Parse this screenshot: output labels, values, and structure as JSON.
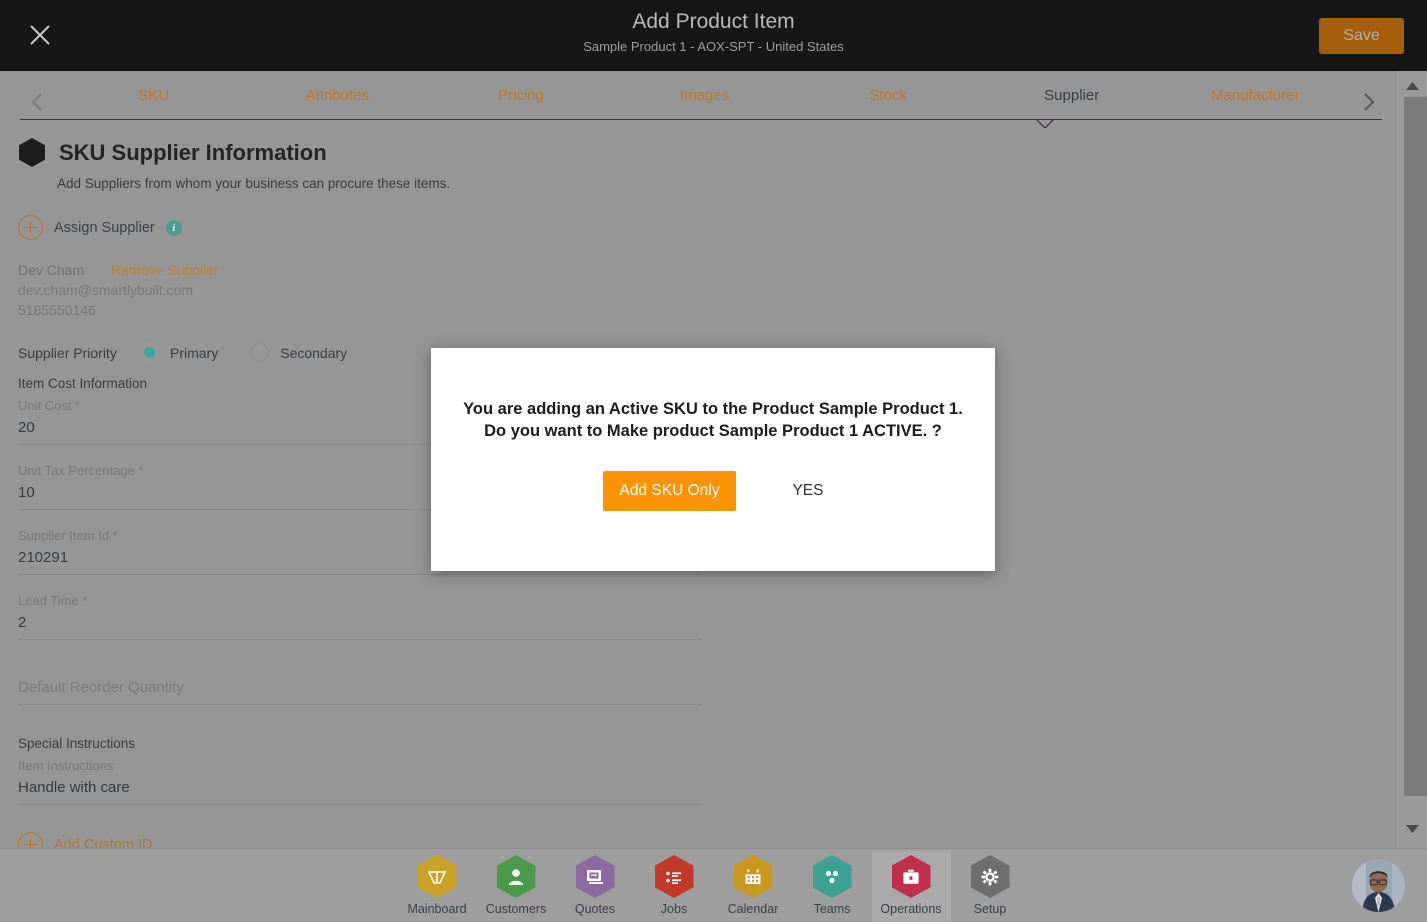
{
  "header": {
    "close_icon": "close-icon",
    "title": "Add Product Item",
    "subtitle": "Sample Product 1 - AOX-SPT - United States",
    "save_label": "Save"
  },
  "tabbar": {
    "prev_icon": "chevron-left-icon",
    "next_icon": "chevron-right-icon",
    "active_tab": "Supplier",
    "tabs": [
      {
        "label": "SKU"
      },
      {
        "label": "Attributes"
      },
      {
        "label": "Pricing"
      },
      {
        "label": "Images"
      },
      {
        "label": "Stock"
      },
      {
        "label": "Supplier"
      },
      {
        "label": "Manufacturer"
      }
    ]
  },
  "section": {
    "title": "SKU Supplier Information",
    "subtitle": "Add Suppliers from whom your business can procure these items.",
    "assign_supplier_label": "Assign Supplier",
    "info_icon_char": "i"
  },
  "supplier": {
    "name": "Dev Cham",
    "remove_label": "Remove Supplier",
    "email": "dev.cham@smartlybuilt.com",
    "phone": "5185550146",
    "priority_label": "Supplier Priority",
    "priority_options": [
      {
        "label": "Primary",
        "selected": true
      },
      {
        "label": "Secondary",
        "selected": false
      }
    ]
  },
  "cost_section": {
    "heading": "Item Cost Information",
    "fields": [
      {
        "label": "Unit Cost *",
        "value": "20"
      },
      {
        "label": "Unit Tax Percentage *",
        "value": "10"
      },
      {
        "label": "Supplier Item Id *",
        "value": "210291"
      },
      {
        "label": "Lead Time *",
        "value": "2"
      }
    ],
    "reorder_placeholder": "Default Reorder Quantity"
  },
  "instructions_section": {
    "heading": "Special Instructions",
    "field_label": "Item Instructions",
    "field_value": "Handle with care"
  },
  "add_custom_id_label": "Add Custom ID",
  "modal": {
    "message": "You are adding an Active SKU to the Product Sample Product 1. Do you want to Make product Sample Product 1 ACTIVE. ?",
    "primary_label": "Add SKU Only",
    "secondary_label": "YES",
    "primary_color": "#f89406"
  },
  "bottomnav": {
    "items": [
      {
        "label": "Mainboard",
        "icon": "mainboard-icon",
        "color": "#c9a227",
        "active": false
      },
      {
        "label": "Customers",
        "icon": "customers-icon",
        "color": "#4a9a4a",
        "active": false
      },
      {
        "label": "Quotes",
        "icon": "quotes-icon",
        "color": "#8a6aa0",
        "active": false
      },
      {
        "label": "Jobs",
        "icon": "jobs-icon",
        "color": "#c0392b",
        "active": false
      },
      {
        "label": "Calendar",
        "icon": "calendar-icon",
        "color": "#c9991f",
        "active": false
      },
      {
        "label": "Teams",
        "icon": "teams-icon",
        "color": "#3da294",
        "active": false
      },
      {
        "label": "Operations",
        "icon": "operations-icon",
        "color": "#c0304a",
        "active": true
      },
      {
        "label": "Setup",
        "icon": "setup-icon",
        "color": "#6e6e6e",
        "active": false
      }
    ]
  },
  "scrollbar": {
    "up_icon": "scroll-up-icon",
    "down_icon": "scroll-down-icon"
  }
}
